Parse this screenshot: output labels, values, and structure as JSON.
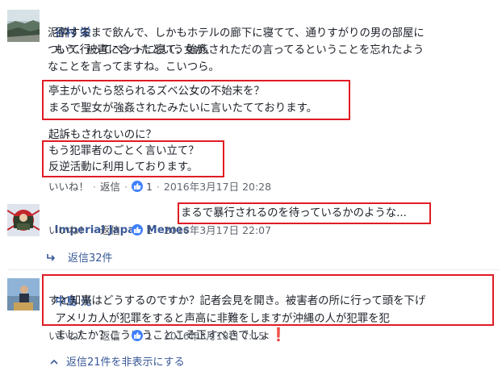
{
  "comments": [
    {
      "author": "谷村 栄",
      "lines": [
        "もう、被害に合ったという女が、",
        "泥酔するまで飲んで、しかもホテルの廊下に寝てて、通りすがりの男の部屋に",
        "ついて行ってベットに寝て、強姦されただの言ってるということを忘れたよう",
        "なことを言ってますね。こいつら。"
      ],
      "quote1": [
        "亭主がいたら怒られるズベ公女の不始末を？",
        "まるで聖女が強姦されたみたいに言いたてております。"
      ],
      "plain": "起訴もされないのに？",
      "quote2": [
        "もう犯罪者のごとく言い立て？",
        "反逆活動に利用しております。"
      ],
      "like": "いいね！",
      "reply": "返信",
      "likes": "1",
      "date": "2016年3月17日 20:28"
    },
    {
      "author": "Imperial Japan Memes",
      "text": "まるで暴行されるのを待っているかのような...",
      "like": "いいね！",
      "reply": "返信",
      "likes": "1",
      "date": "2016年3月17日 22:07",
      "replies_link": "返信32件"
    },
    {
      "author": "中島 光",
      "line1": "アメリカ人が犯罪をすると声高に非難をしますが沖縄の人が犯罪を犯",
      "line2": "すと知事はどうするのですか？記者会見を開き。被害者の所に行って頭を下げ",
      "line3": "ましたか？こういうことこそ正すべきでしょ",
      "exclaim": "❗",
      "like": "いいね！",
      "reply": "返信",
      "likes": "1",
      "date": "2016年3月18日 7:15",
      "hide_replies": "返信21件を非表示にする"
    }
  ],
  "colors": {
    "name": "#385898",
    "highlight": "#e01b24",
    "like_badge": "#4080ff"
  }
}
